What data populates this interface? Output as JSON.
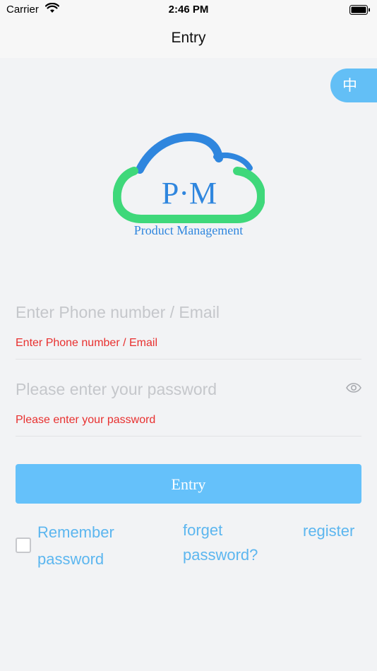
{
  "status_bar": {
    "carrier": "Carrier",
    "time": "2:46 PM"
  },
  "nav": {
    "title": "Entry"
  },
  "language_toggle": {
    "label": "中"
  },
  "logo": {
    "monogram": "P·M",
    "tagline": "Product Management"
  },
  "form": {
    "account": {
      "placeholder": "Enter Phone number / Email",
      "value": "",
      "error": "Enter Phone number / Email"
    },
    "password": {
      "placeholder": "Please enter your password",
      "value": "",
      "error": "Please enter your password"
    },
    "submit_label": "Entry"
  },
  "footer_links": {
    "remember_label": "Remember password",
    "remember_checked": false,
    "forgot_label": "forget password?",
    "register_label": "register"
  },
  "colors": {
    "accent": "#65c1fa",
    "link": "#5cb6ef",
    "error": "#e8302f",
    "logo_blue": "#2f86de",
    "logo_green": "#3fd87a"
  },
  "icons": [
    "wifi-icon",
    "battery-icon",
    "eye-icon",
    "checkbox-icon"
  ]
}
